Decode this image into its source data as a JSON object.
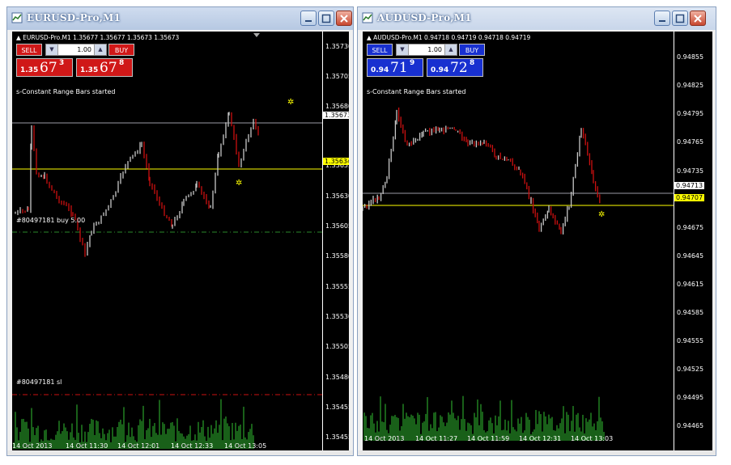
{
  "colors": {
    "bull": "#c8c8c8",
    "bear": "#cc1010",
    "volume": "#2aa02a",
    "sell_red": "#d01818",
    "buy_blue": "#1830d0",
    "level_yellow": "#ffff00"
  },
  "window1": {
    "title": "EURUSD-Pro,M1",
    "header": "EURUSD-Pro.M1  1.35677 1.35677 1.35673 1.35673",
    "sell": "SELL",
    "buy": "BUY",
    "lot": "1.00",
    "bid": {
      "small": "1.35",
      "big": "67",
      "sup": "3"
    },
    "ask": {
      "small": "1.35",
      "big": "67",
      "sup": "8"
    },
    "status": "s-Constant Range Bars started",
    "order_label": "#80497181 buy 5.00",
    "sl_label": "#80497181 sl",
    "price_labels": [
      "1.35730",
      "1.35705",
      "1.35680",
      "1.35655",
      "1.35630",
      "1.35605",
      "1.35580",
      "1.35555",
      "1.35530",
      "1.35505",
      "1.35480",
      "1.35455",
      "1.35430",
      "1.35405"
    ],
    "price_tag": "1.35673",
    "yellow_tag": "1.35634",
    "time_labels": [
      "14 Oct 2013",
      "14 Oct 11:30",
      "14 Oct 12:01",
      "14 Oct 12:33",
      "14 Oct 13:05"
    ]
  },
  "window2": {
    "title": "AUDUSD-Pro,M1",
    "header": "AUDUSD-Pro.M1  0.94718 0.94719 0.94718 0.94719",
    "sell": "SELL",
    "buy": "BUY",
    "lot": "1.00",
    "bid": {
      "small": "0.94",
      "big": "71",
      "sup": "9"
    },
    "ask": {
      "small": "0.94",
      "big": "72",
      "sup": "8"
    },
    "status": "s-Constant Range Bars started",
    "price_labels": [
      "0.94855",
      "0.94825",
      "0.94795",
      "0.94765",
      "0.94735",
      "0.94705",
      "0.94675",
      "0.94645",
      "0.94615",
      "0.94585",
      "0.94555",
      "0.94525",
      "0.94495",
      "0.94465"
    ],
    "price_tag": "0.94713",
    "yellow_tag": "0.94707",
    "time_labels": [
      "14 Oct 2013",
      "14 Oct 11:27",
      "14 Oct 11:59",
      "14 Oct 12:31",
      "14 Oct 13:03"
    ]
  }
}
